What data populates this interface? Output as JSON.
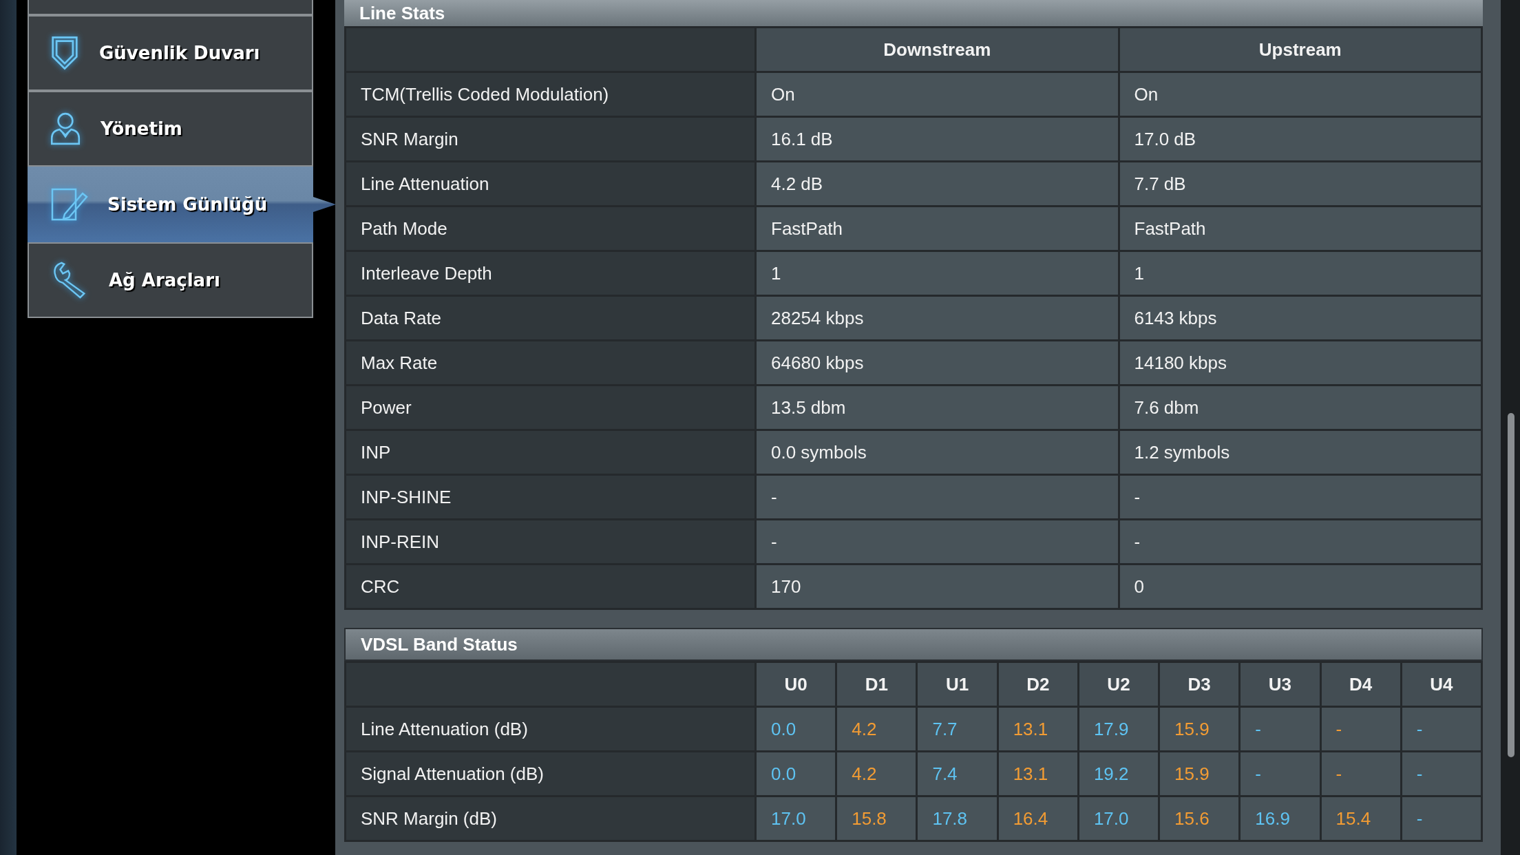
{
  "sidebar": {
    "items": [
      {
        "label": "Güvenlik Duvarı",
        "selected": false
      },
      {
        "label": "Yönetim",
        "selected": false
      },
      {
        "label": "Sistem Günlüğü",
        "selected": true
      },
      {
        "label": "Ağ Araçları",
        "selected": false
      }
    ]
  },
  "line_stats": {
    "title": "Line Stats",
    "columns": [
      "Downstream",
      "Upstream"
    ],
    "rows": [
      {
        "label": "TCM(Trellis Coded Modulation)",
        "downstream": "On",
        "upstream": "On"
      },
      {
        "label": "SNR Margin",
        "downstream": "16.1 dB",
        "upstream": "17.0 dB"
      },
      {
        "label": "Line Attenuation",
        "downstream": "4.2 dB",
        "upstream": "7.7 dB"
      },
      {
        "label": "Path Mode",
        "downstream": "FastPath",
        "upstream": "FastPath"
      },
      {
        "label": "Interleave Depth",
        "downstream": "1",
        "upstream": "1"
      },
      {
        "label": "Data Rate",
        "downstream": "28254 kbps",
        "upstream": "6143 kbps"
      },
      {
        "label": "Max Rate",
        "downstream": "64680 kbps",
        "upstream": "14180 kbps"
      },
      {
        "label": "Power",
        "downstream": "13.5 dbm",
        "upstream": "7.6 dbm"
      },
      {
        "label": "INP",
        "downstream": "0.0 symbols",
        "upstream": "1.2 symbols"
      },
      {
        "label": "INP-SHINE",
        "downstream": "-",
        "upstream": "-"
      },
      {
        "label": "INP-REIN",
        "downstream": "-",
        "upstream": "-"
      },
      {
        "label": "CRC",
        "downstream": "170",
        "upstream": "0"
      }
    ]
  },
  "vdsl_band_status": {
    "title": "VDSL Band Status",
    "columns": [
      {
        "label": "U0",
        "color": "#5ec3f2"
      },
      {
        "label": "D1",
        "color": "#f39c33"
      },
      {
        "label": "U1",
        "color": "#5ec3f2"
      },
      {
        "label": "D2",
        "color": "#f39c33"
      },
      {
        "label": "U2",
        "color": "#5ec3f2"
      },
      {
        "label": "D3",
        "color": "#f39c33"
      },
      {
        "label": "U3",
        "color": "#5ec3f2"
      },
      {
        "label": "D4",
        "color": "#f39c33"
      },
      {
        "label": "U4",
        "color": "#5ec3f2"
      }
    ],
    "rows": [
      {
        "label": "Line Attenuation (dB)",
        "values": [
          "0.0",
          "4.2",
          "7.7",
          "13.1",
          "17.9",
          "15.9",
          "-",
          "-",
          "-"
        ]
      },
      {
        "label": "Signal Attenuation (dB)",
        "values": [
          "0.0",
          "4.2",
          "7.4",
          "13.1",
          "19.2",
          "15.9",
          "-",
          "-",
          "-"
        ]
      },
      {
        "label": "SNR Margin (dB)",
        "values": [
          "17.0",
          "15.8",
          "17.8",
          "16.4",
          "17.0",
          "15.6",
          "16.9",
          "15.4",
          "-"
        ]
      }
    ]
  }
}
